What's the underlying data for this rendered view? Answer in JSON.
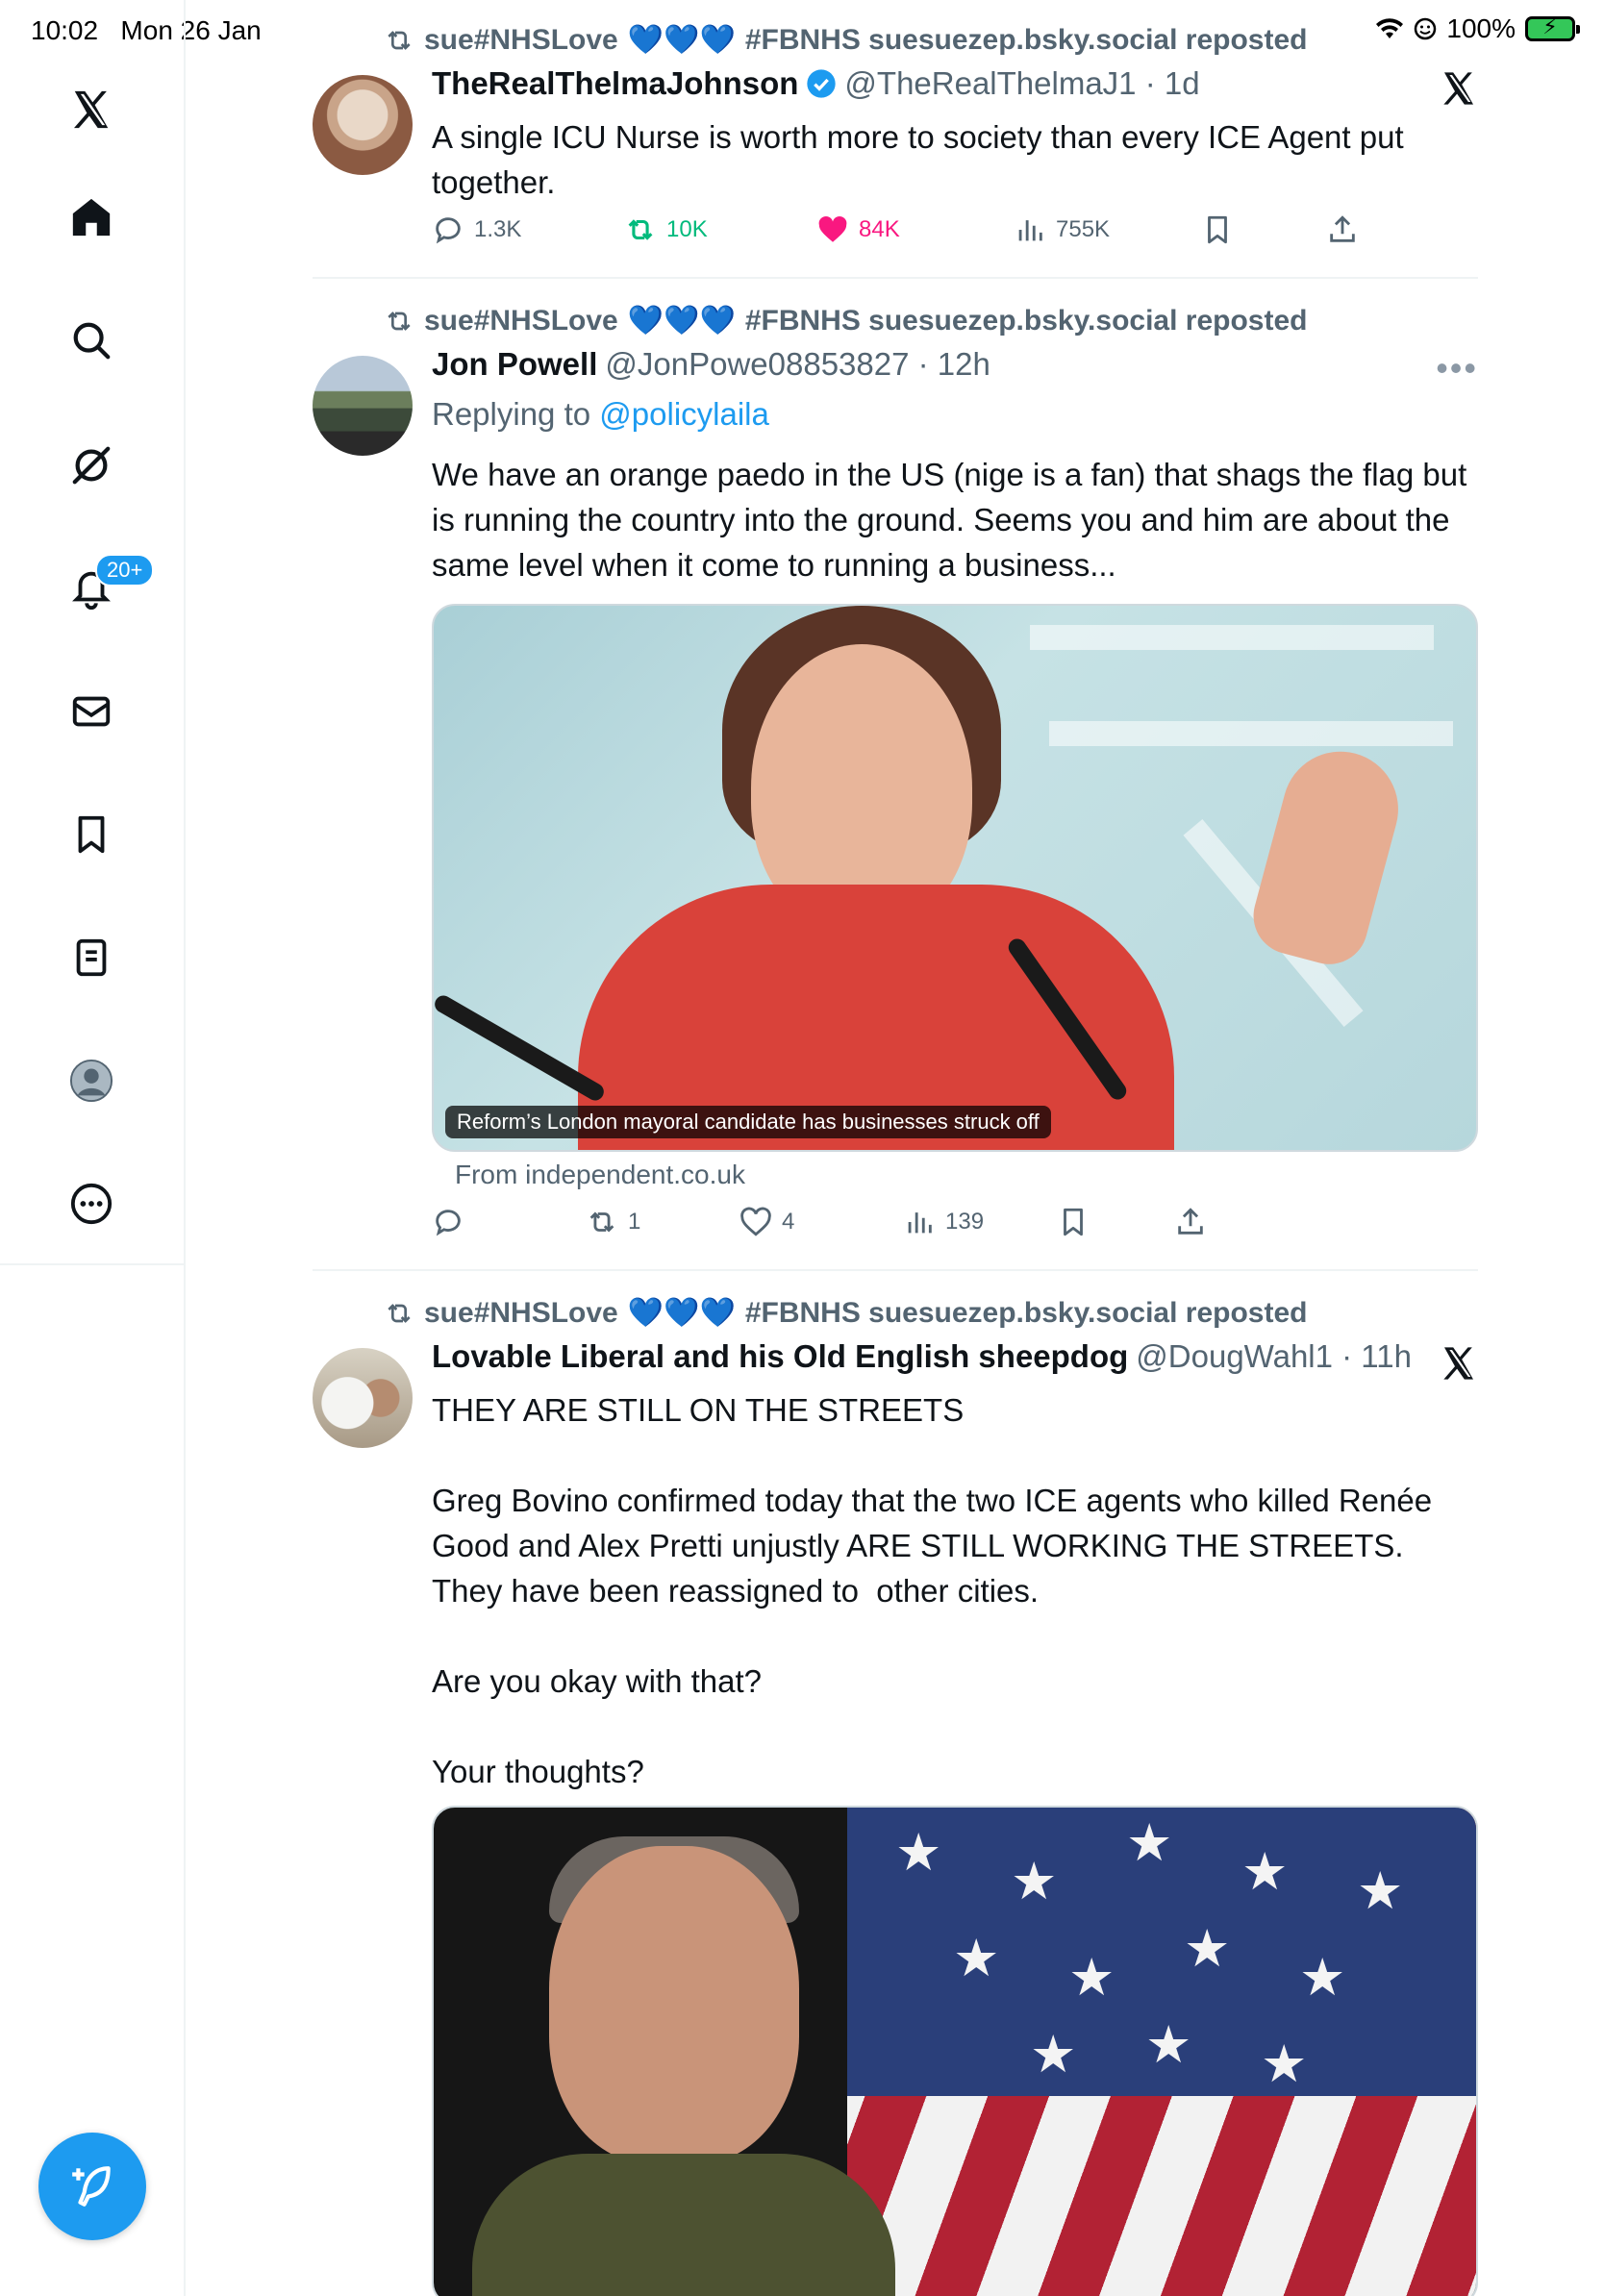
{
  "status_bar": {
    "time": "10:02",
    "date": "Mon 26 Jan",
    "battery": "100%"
  },
  "sidebar": {
    "items": [
      {
        "name": "x-logo",
        "icon": "x-logo-icon"
      },
      {
        "name": "home",
        "icon": "home-icon"
      },
      {
        "name": "search",
        "icon": "search-icon"
      },
      {
        "name": "grok",
        "icon": "grok-icon"
      },
      {
        "name": "notifications",
        "icon": "bell-icon",
        "badge": "20+"
      },
      {
        "name": "messages",
        "icon": "mail-icon"
      },
      {
        "name": "bookmarks",
        "icon": "bookmark-icon"
      },
      {
        "name": "lists",
        "icon": "list-icon"
      },
      {
        "name": "profile",
        "icon": "avatar-icon"
      },
      {
        "name": "more",
        "icon": "more-icon"
      }
    ],
    "compose_icon": "compose-icon"
  },
  "colors": {
    "accent": "#1d9bf0",
    "retweet": "#00ba7c",
    "like": "#f91880",
    "muted": "#536471"
  },
  "feed": {
    "tweets": [
      {
        "repost_by_prefix": "sue#NHSLove",
        "repost_by_suffix": "#FBNHS suesuezep.bsky.social reposted",
        "name": "TheRealThelmaJohnson",
        "verified": true,
        "handle_time": "@TheRealThelmaJ1 · 1d",
        "text": "A single ICU Nurse is worth more to society than every ICE Agent put together.",
        "replies": "1.3K",
        "retweets": "10K",
        "likes": "84K",
        "views": "755K"
      },
      {
        "repost_by_prefix": "sue#NHSLove",
        "repost_by_suffix": "#FBNHS suesuezep.bsky.social reposted",
        "name": "Jon Powell",
        "handle_time": "@JonPowe08853827 · 12h",
        "replying_label": "Replying to",
        "replying_handle": "@policylaila",
        "text": "We have an orange paedo in the US (nige is a fan) that shags the flag but is running the country into the ground. Seems you and him are about the same level when it come to running a business...",
        "media_caption": "Reform’s London mayoral candidate has businesses struck off",
        "media_source": "From independent.co.uk",
        "replies": "",
        "retweets": "1",
        "likes": "4",
        "views": "139"
      },
      {
        "repost_by_prefix": "sue#NHSLove",
        "repost_by_suffix": "#FBNHS suesuezep.bsky.social reposted",
        "name": "Lovable Liberal and his Old English sheepdog",
        "handle_time": "@DougWahl1 · 11h",
        "text": "THEY ARE STILL ON THE STREETS\n\nGreg Bovino confirmed today that the two ICE agents who killed Renée Good and Alex Pretti unjustly ARE STILL WORKING THE STREETS. They have been reassigned to  other cities.\n\nAre you okay with that?\n\nYour thoughts?"
      }
    ]
  }
}
